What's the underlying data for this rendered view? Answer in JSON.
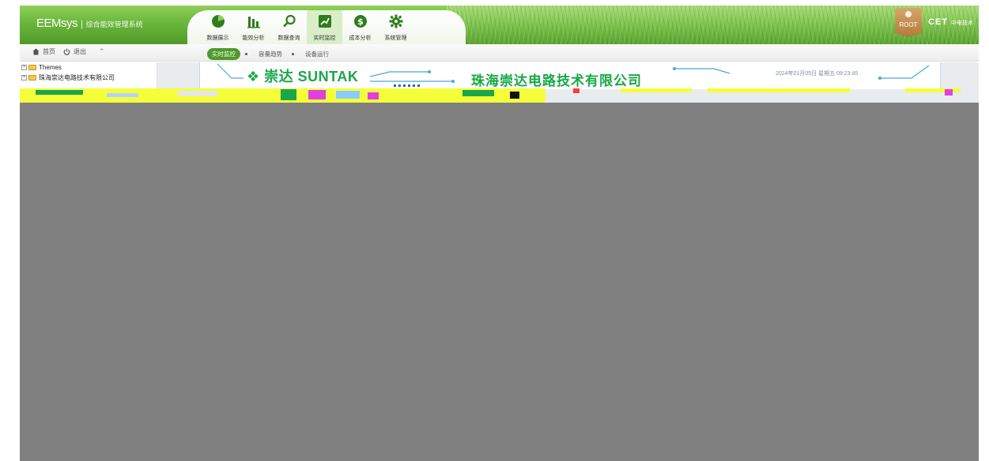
{
  "header": {
    "app_name": "EEMsys",
    "separator": "|",
    "subtitle": "综合能效管理系统",
    "nav": [
      {
        "label": "数据展示",
        "icon": "pie-chart-icon",
        "active": false
      },
      {
        "label": "能效分析",
        "icon": "bar-chart-icon",
        "active": false
      },
      {
        "label": "数据查询",
        "icon": "search-icon",
        "active": false
      },
      {
        "label": "实时监控",
        "icon": "line-chart-icon",
        "active": true
      },
      {
        "label": "成本分析",
        "icon": "dollar-icon",
        "active": false
      },
      {
        "label": "系统管理",
        "icon": "gear-icon",
        "active": false
      }
    ],
    "user": "ROOT",
    "brand": "CET",
    "brand_cn": "中电技术"
  },
  "toolbar": {
    "home_label": "首页",
    "logout_label": "退出",
    "subtabs": [
      {
        "label": "实时监控",
        "active": true
      },
      {
        "label": "容量趋势",
        "active": false
      },
      {
        "label": "设备运行",
        "active": false
      }
    ]
  },
  "sidebar": {
    "items": [
      {
        "label": "Themes"
      },
      {
        "label": "珠海崇达电路技术有限公司"
      }
    ]
  },
  "banner": {
    "logo_text": "崇达 SUNTAK",
    "company": "珠海崇达电路技术有限公司",
    "datetime": "2024年01月05日 星期五 09:23:45"
  },
  "colors": {
    "header_green": "#6ab63c",
    "brand_green": "#1aa64a",
    "active_tab": "#4e9a2a",
    "overlay_gray": "#808080",
    "badge_brown": "#c48a4c"
  }
}
